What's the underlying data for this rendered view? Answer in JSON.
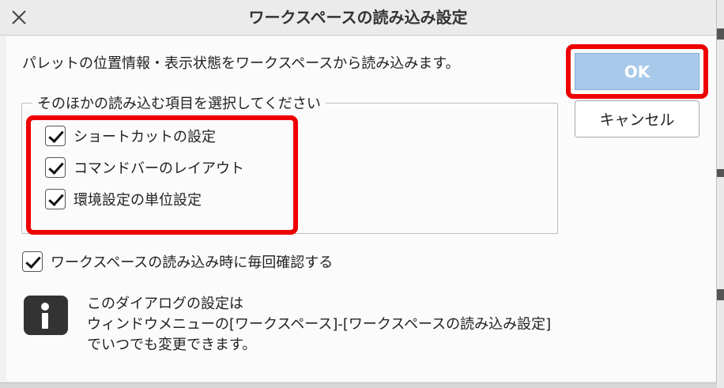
{
  "dialog": {
    "title": "ワークスペースの読み込み設定",
    "description": "パレットの位置情報・表示状態をワークスペースから読み込みます。",
    "group_label": "そのほかの読み込む項目を選択してください",
    "options": [
      {
        "label": "ショートカットの設定",
        "checked": true
      },
      {
        "label": "コマンドバーのレイアウト",
        "checked": true
      },
      {
        "label": "環境設定の単位設定",
        "checked": true
      }
    ],
    "confirm_option": {
      "label": "ワークスペースの読み込み時に毎回確認する",
      "checked": true
    },
    "buttons": {
      "ok": "OK",
      "cancel": "キャンセル"
    },
    "info": {
      "icon": "info-icon",
      "line1": "このダイアログの設定は",
      "line2": "ウィンドウメニューの[ワークスペース]-[ワークスペースの読み込み設定]",
      "line3": "でいつでも変更できます。"
    },
    "highlight_color": "#ee0000",
    "ok_button_color": "#a9c9ea"
  }
}
